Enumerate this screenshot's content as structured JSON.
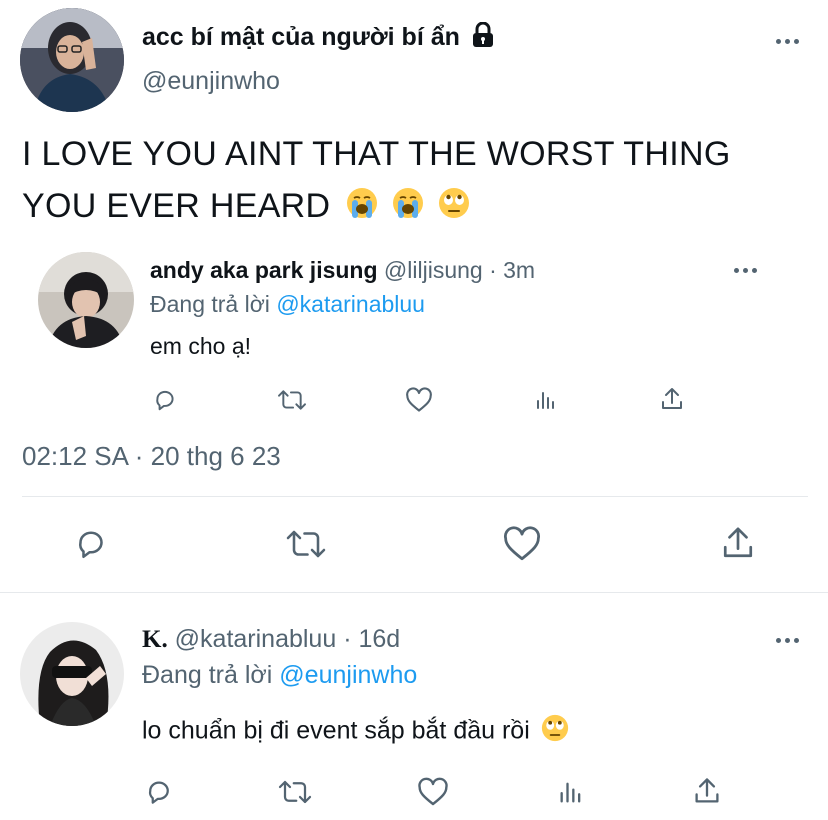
{
  "main_tweet": {
    "display_name": "acc bí mật của người bí ẩn",
    "handle": "@eunjinwho",
    "text": "I LOVE YOU AINT THAT THE WORST THING YOU EVER HEARD",
    "text_line1": "I LOVE YOU AINT THAT THE WORST THING",
    "text_line2": "YOU EVER HEARD",
    "timestamp": "02:12 SA · 20 thg 6 23"
  },
  "quoted_tweet": {
    "display_name": "andy aka park jisung",
    "handle": "@liljisung",
    "time": "· 3m",
    "replying_prefix": "Đang trả lời",
    "replying_to": "@katarinabluu",
    "text": "em cho ạ!"
  },
  "reply_tweet": {
    "display_name": "K.",
    "handle": "@katarinabluu",
    "time": "· 16d",
    "replying_prefix": "Đang trả lời",
    "replying_to": "@eunjinwho",
    "text": "lo chuẩn bị đi event sắp bắt đầu rồi"
  },
  "icons": {
    "lock": "lock-icon",
    "more": "more-icon",
    "reply": "reply-icon",
    "retweet": "retweet-icon",
    "like": "like-icon",
    "views": "views-icon",
    "share": "share-icon",
    "emoji_crying": "loudly-crying-face-emoji",
    "emoji_eyeroll": "face-with-rolling-eyes-emoji"
  },
  "colors": {
    "text": "#0f1419",
    "muted": "#536471",
    "link": "#1d9bf0",
    "divider": "#e6e9ec"
  }
}
